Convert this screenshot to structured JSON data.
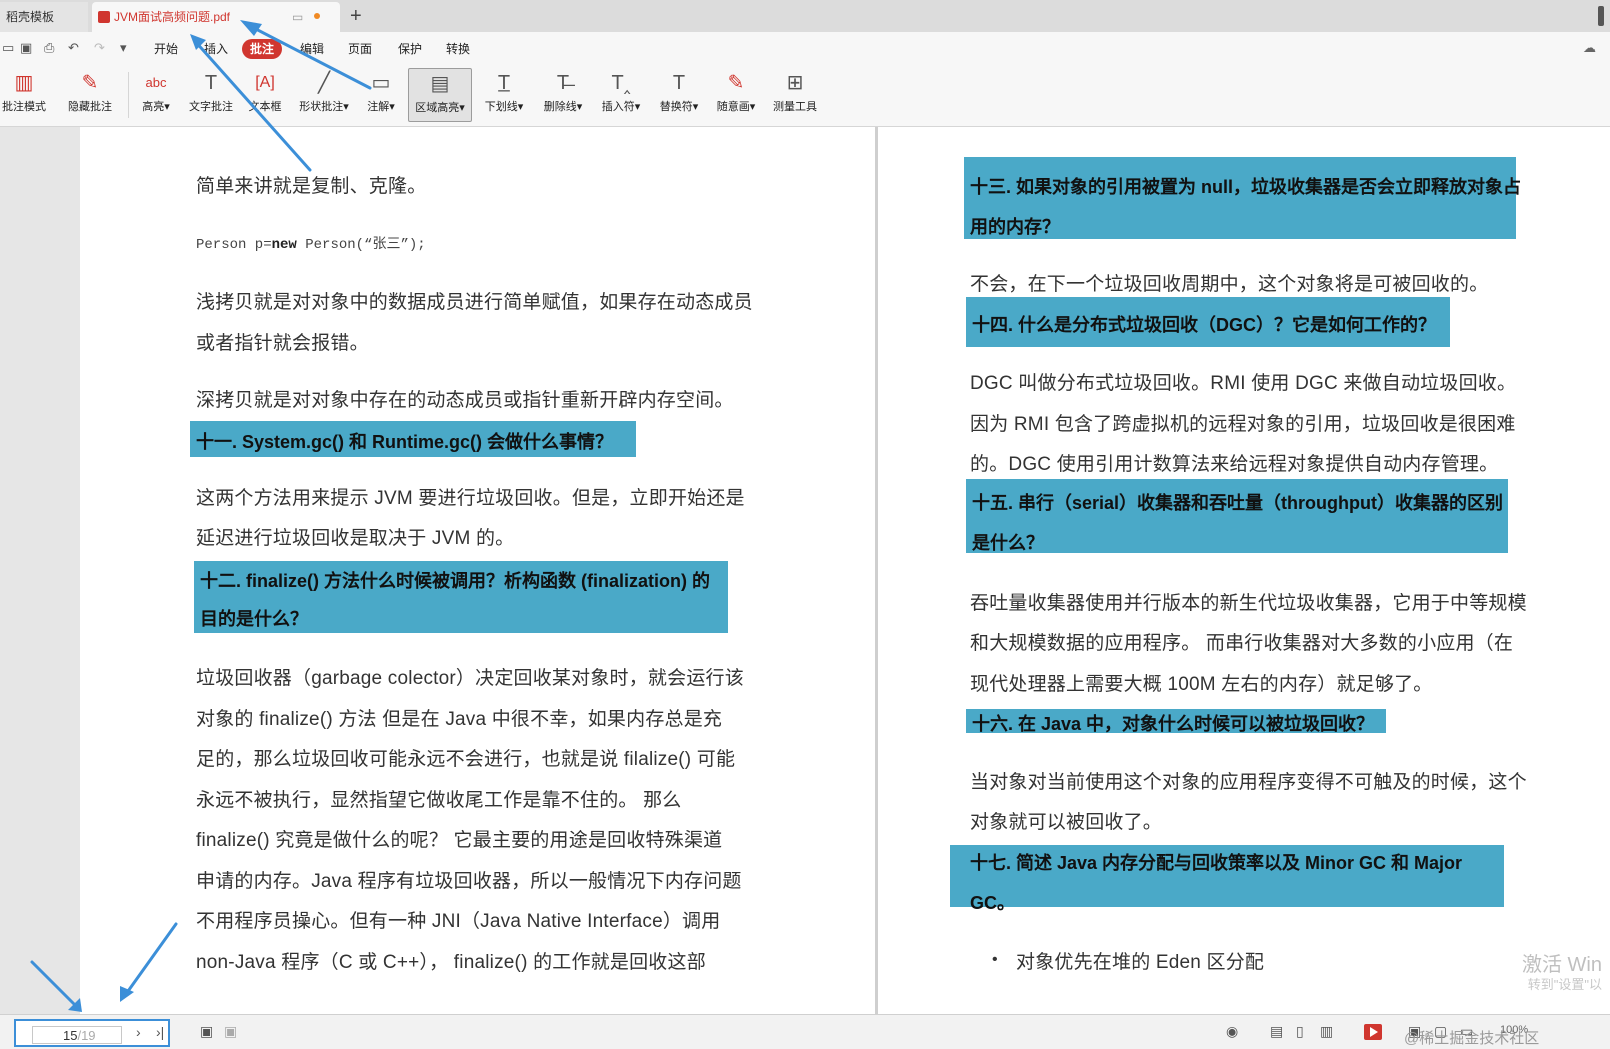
{
  "tabs": {
    "t1": "稻壳模板",
    "t2": "JVM面试高频问题.pdf",
    "new_tab": "+"
  },
  "menu": {
    "items": [
      "开始",
      "插入",
      "批注",
      "编辑",
      "页面",
      "保护",
      "转换"
    ],
    "active": "批注"
  },
  "ribbon": {
    "items": [
      {
        "label": "批注模式",
        "icon": "annotation-mode-icon"
      },
      {
        "label": "隐藏批注",
        "icon": "hide-annotation-icon"
      },
      {
        "label": "高亮",
        "icon": "highlight-icon"
      },
      {
        "label": "文字批注",
        "icon": "text-annotation-icon"
      },
      {
        "label": "文本框",
        "icon": "textbox-icon"
      },
      {
        "label": "形状批注",
        "icon": "shape-annotation-icon"
      },
      {
        "label": "注解",
        "icon": "note-icon"
      },
      {
        "label": "区域高亮",
        "icon": "area-highlight-icon"
      },
      {
        "label": "下划线",
        "icon": "underline-icon"
      },
      {
        "label": "删除线",
        "icon": "strikethrough-icon"
      },
      {
        "label": "插入符",
        "icon": "insert-caret-icon"
      },
      {
        "label": "替换符",
        "icon": "replace-caret-icon"
      },
      {
        "label": "随意画",
        "icon": "freehand-icon"
      },
      {
        "label": "测量工具",
        "icon": "measure-icon"
      }
    ]
  },
  "left_page": {
    "p1": "简单来讲就是复制、克隆。",
    "code_a": "Person p=",
    "code_b": "new",
    "code_c": " Person(“张三”);",
    "p2a": "浅拷贝就是对对象中的数据成员进行简单赋值，如果存在动态成员",
    "p2b": "或者指针就会报错。",
    "p3": "深拷贝就是对对象中存在的动态成员或指针重新开辟内存空间。",
    "h11": "十一. System.gc() 和 Runtime.gc() 会做什么事情？",
    "p4a": "这两个方法用来提示 JVM 要进行垃圾回收。但是，立即开始还是",
    "p4b": "延迟进行垃圾回收是取决于 JVM 的。",
    "h12a": "十二. finalize() 方法什么时候被调用？析构函数 (finalization) 的",
    "h12b": "目的是什么？",
    "p5": [
      "垃圾回收器（garbage colector）决定回收某对象时，就会运行该",
      "对象的 finalize() 方法 但是在 Java 中很不幸，如果内存总是充",
      "足的，那么垃圾回收可能永远不会进行，也就是说 filalize() 可能",
      "永远不被执行，显然指望它做收尾工作是靠不住的。 那么",
      "finalize() 究竟是做什么的呢？ 它最主要的用途是回收特殊渠道",
      "申请的内存。Java 程序有垃圾回收器，所以一般情况下内存问题",
      "不用程序员操心。但有一种 JNI（Java Native Interface）调用",
      "non-Java 程序（C 或 C++）， finalize() 的工作就是回收这部"
    ]
  },
  "right_page": {
    "h13a": "十三. 如果对象的引用被置为 null，垃圾收集器是否会立即释放对象占",
    "h13b": "用的内存？",
    "p1": "不会，在下一个垃圾回收周期中，这个对象将是可被回收的。",
    "h14": "十四. 什么是分布式垃圾回收（DGC）？它是如何工作的？",
    "p2a": "DGC 叫做分布式垃圾回收。RMI 使用 DGC 来做自动垃圾回收。",
    "p2b": "因为 RMI 包含了跨虚拟机的远程对象的引用，垃圾回收是很困难",
    "p2c": "的。DGC 使用引用计数算法来给远程对象提供自动内存管理。",
    "h15a": "十五. 串行（serial）收集器和吞吐量（throughput）收集器的区别",
    "h15b": "是什么？",
    "p3a": "吞吐量收集器使用并行版本的新生代垃圾收集器，它用于中等规模",
    "p3b": "和大规模数据的应用程序。 而串行收集器对大多数的小应用（在",
    "p3c": "现代处理器上需要大概 100M 左右的内存）就足够了。",
    "h16": "十六. 在 Java 中，对象什么时候可以被垃圾回收？",
    "p4a": "当对象对当前使用这个对象的应用程序变得不可触及的时候，这个",
    "p4b": "对象就可以被回收了。",
    "h17a": "十七. 简述 Java 内存分配与回收策率以及 Minor GC 和 Major",
    "h17b": "GC。",
    "bullet": "•",
    "li1": "对象优先在堆的 Eden 区分配"
  },
  "watermark": {
    "line1": "激活 Win",
    "line2": "转到\"设置\"以"
  },
  "statusbar": {
    "current_page": "15",
    "total_pages": "/19",
    "zoom": "100%",
    "credit": "@稀土掘金技术社区"
  },
  "colors": {
    "highlight": "#4aa9c8",
    "accent_red": "#d0362f",
    "annotation_blue": "#3c8fd8"
  }
}
